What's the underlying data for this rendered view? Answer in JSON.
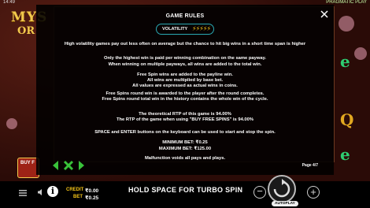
{
  "status": {
    "time": "14:49",
    "brand": "PRAGMATIC PLAY"
  },
  "game": {
    "logo_line1": "MYS",
    "logo_line2": "OR",
    "buy_free_label": "BUY F"
  },
  "rules": {
    "title": "GAME RULES",
    "volatility_label": "VOLATILITY",
    "volatility_level": 5,
    "volatility_icon": "lightning-bolt-icon",
    "lines": [
      "High volatility games pay out less often on average but the chance to hit big wins in a short time span is higher",
      "Only the highest win is paid per winning combination on the same payway.",
      "When winning on multiple payways, all wins are added to the total win.",
      "Free Spin wins are added to the payline win.",
      "All wins are multiplied by base bet.",
      "All values are expressed as actual wins in coins.",
      "Free Spins round win is awarded to the player after the round completes.",
      "Free Spins round total win in the history contains the whole win of the cycle.",
      "The theoretical RTP of this game is 94.00%",
      "The RTP of the game when using \"BUY FREE SPINS\" is 94.00%",
      "SPACE and ENTER buttons on the keyboard can be used to start and stop the spin.",
      "MINIMUM BET: ₹0.25",
      "MAXIMUM BET: ₹125.00",
      "Malfunction voids all pays and plays."
    ],
    "page_indicator": "Page 4/7"
  },
  "bottom": {
    "credit_label": "CREDIT",
    "credit_value": "₹0.00",
    "bet_label": "BET",
    "bet_value": "₹0.25",
    "message": "HOLD SPACE FOR TURBO SPIN",
    "autoplay_label": "AUTOPLAY"
  },
  "colors": {
    "accent": "#2aa9b3",
    "bolt": "#f5c518",
    "nav_green": "#39c23a",
    "label_yellow": "#f5c518"
  }
}
